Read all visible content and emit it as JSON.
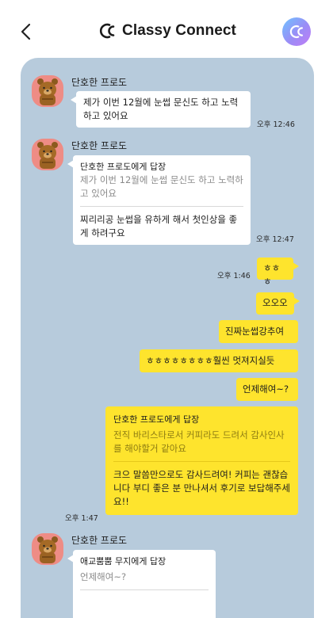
{
  "header": {
    "brand": "Classy Connect"
  },
  "messages": {
    "m1": {
      "sender": "단호한 프로도",
      "text": "제가 이번 12월에 눈썹 문신도 하고 노력하고 있어요",
      "time": "오후 12:46"
    },
    "m2": {
      "sender": "단호한 프로도",
      "reply_title": "단호한 프로도에게 답장",
      "reply_quote": "제가 이번 12월에 눈썹 문신도 하고 노력하고 있어요",
      "text": "찌리리공 눈썹을 유하게 해서 첫인상을 좋게 하려구요",
      "time": "오후 12:47"
    },
    "m3": {
      "text": "ㅎㅎㅎ",
      "time": "오후 1:46"
    },
    "m4": {
      "text": "오오오"
    },
    "m5": {
      "text": "진짜눈썹강추여"
    },
    "m6": {
      "text": "ㅎㅎㅎㅎㅎㅎㅎㅎ훨씬 멋져지실듯"
    },
    "m7": {
      "text": "언제해여~?"
    },
    "m8": {
      "reply_title": "단호한 프로도에게 답장",
      "reply_quote": "전직 바리스타로서 커피라도 드려서 감사인사를 해야할거 같아요",
      "text": "크으 말씀만으로도 감사드려여! 커피는 괜찮습니다 부디 좋은 분 만나셔서 후기로 보답해주세요!!",
      "time": "오후 1:47"
    },
    "m9": {
      "sender": "단호한 프로도",
      "reply_title": "애교뿜뿜 무지에게 답장",
      "reply_quote": "언제해여~?"
    }
  },
  "icons": {
    "back": "chevron-left-icon",
    "logo": "classy-connect-logo",
    "profile": "profile-logo-icon",
    "avatar": "bear-avatar-icon"
  },
  "colors": {
    "chat_bg": "#b7cbdc",
    "my_bubble": "#fee42d",
    "other_bubble": "#ffffff",
    "avatar_bg": "#ee8c85"
  }
}
